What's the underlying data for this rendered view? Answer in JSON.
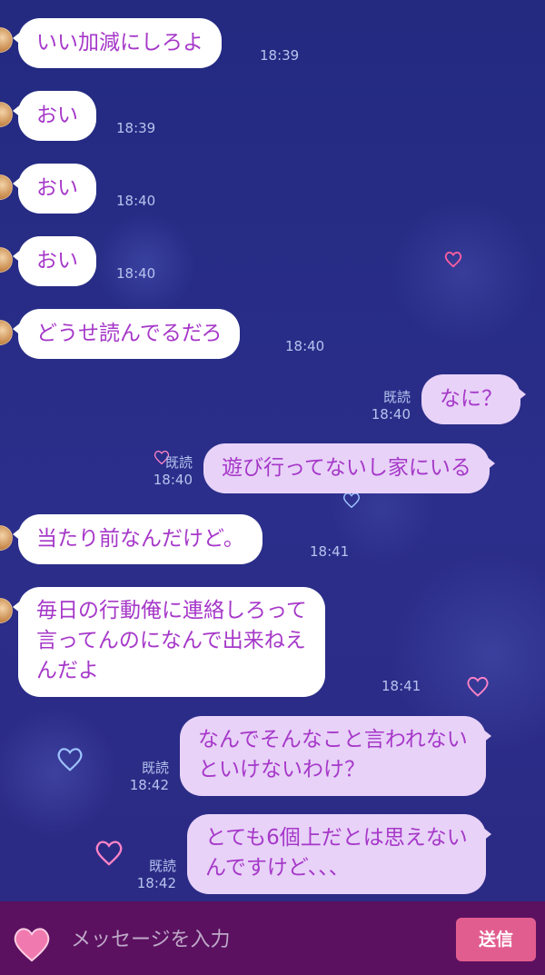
{
  "messages": [
    {
      "side": "in",
      "text": "いい加減にしろよ",
      "time": "18:39"
    },
    {
      "side": "in",
      "text": "おい",
      "time": "18:39"
    },
    {
      "side": "in",
      "text": "おい",
      "time": "18:40"
    },
    {
      "side": "in",
      "text": "おい",
      "time": "18:40"
    },
    {
      "side": "in",
      "text": "どうせ読んでるだろ",
      "time": "18:40"
    },
    {
      "side": "out",
      "text": "なに？",
      "read": "既読",
      "time": "18:40"
    },
    {
      "side": "out",
      "text": "遊び行ってないし家にいる",
      "read": "既読",
      "time": "18:40"
    },
    {
      "side": "in",
      "text": "当たり前なんだけど。",
      "time": "18:41"
    },
    {
      "side": "in",
      "lines": [
        "毎日の行動俺に連絡しろって",
        "言ってんのになんで出来ねえ",
        "んだよ"
      ],
      "time": "18:41"
    },
    {
      "side": "out",
      "lines": [
        "なんでそんなこと言われない",
        "といけないわけ？"
      ],
      "read": "既読",
      "time": "18:42"
    },
    {
      "side": "out",
      "lines": [
        "とても6個上だとは思えない",
        "んですけど、、、"
      ],
      "read": "既読",
      "time": "18:42"
    }
  ],
  "input": {
    "placeholder": "メッセージを入力"
  },
  "send_button": {
    "label": "送信"
  },
  "icons": {
    "sticker": "heart-icon"
  },
  "colors": {
    "background": "#2a2d86",
    "bubble_in": "#ffffff",
    "bubble_out": "#e8d2f8",
    "text": "#a638c9",
    "bar": "#5b1160",
    "send": "#e25d8f"
  }
}
